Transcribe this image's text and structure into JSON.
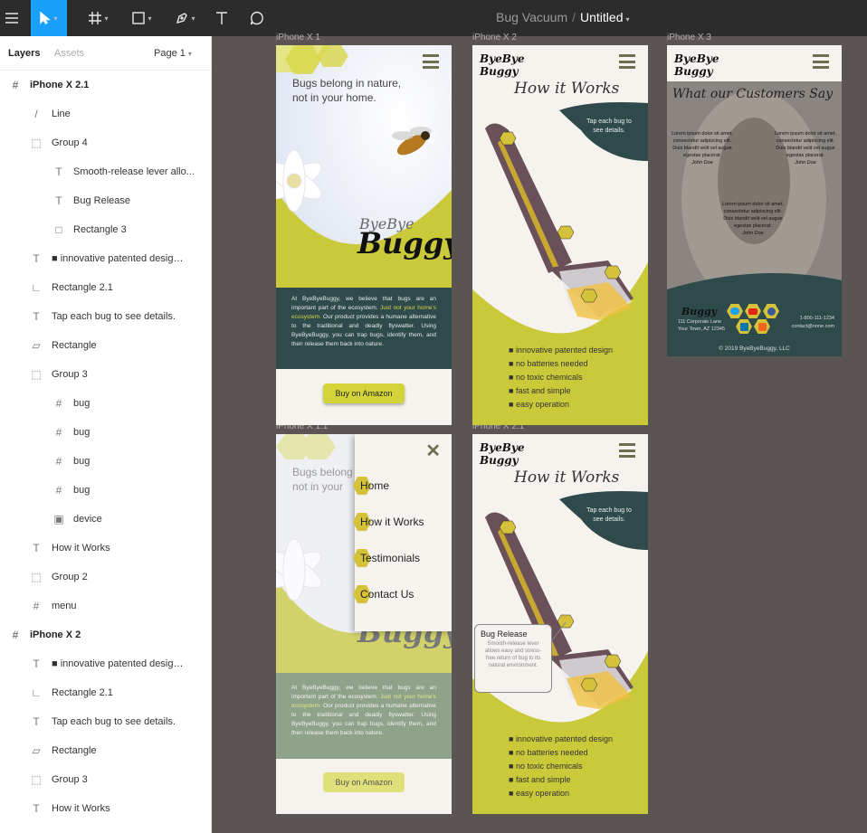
{
  "toolbar": {
    "project": "Bug Vacuum",
    "separator": "/",
    "document": "Untitled",
    "tools": [
      "menu-icon",
      "move-tool-icon",
      "frame-tool-icon",
      "shape-tool-icon",
      "pen-tool-icon",
      "text-tool-icon",
      "comment-tool-icon"
    ]
  },
  "panel": {
    "tab_layers": "Layers",
    "tab_assets": "Assets",
    "page": "Page 1",
    "layers": [
      {
        "label": "iPhone X 2.1",
        "icon": "#",
        "level": 0,
        "bold": true
      },
      {
        "label": "Line",
        "icon": "/",
        "level": 1
      },
      {
        "label": "Group 4",
        "icon": "⬚",
        "level": 1
      },
      {
        "label": "Smooth-release lever allo...",
        "icon": "T",
        "level": 2
      },
      {
        "label": "Bug Release",
        "icon": "T",
        "level": 2
      },
      {
        "label": "Rectangle 3",
        "icon": "□",
        "level": 2
      },
      {
        "label": "■ innovative patented design ...",
        "icon": "T",
        "level": 1
      },
      {
        "label": "Rectangle 2.1",
        "icon": "∟",
        "level": 1
      },
      {
        "label": "Tap each bug to see details.",
        "icon": "T",
        "level": 1
      },
      {
        "label": "Rectangle",
        "icon": "⏥",
        "level": 1
      },
      {
        "label": "Group 3",
        "icon": "⬚",
        "level": 1
      },
      {
        "label": "bug",
        "icon": "#",
        "level": 2
      },
      {
        "label": "bug",
        "icon": "#",
        "level": 2
      },
      {
        "label": "bug",
        "icon": "#",
        "level": 2
      },
      {
        "label": "bug",
        "icon": "#",
        "level": 2
      },
      {
        "label": "device",
        "icon": "▣",
        "level": 2
      },
      {
        "label": "How it Works",
        "icon": "T",
        "level": 1
      },
      {
        "label": "Group 2",
        "icon": "⬚",
        "level": 1
      },
      {
        "label": "menu",
        "icon": "#",
        "level": 1
      },
      {
        "label": "iPhone X 2",
        "icon": "#",
        "level": 0,
        "bold": true
      },
      {
        "label": "■ innovative patented design ...",
        "icon": "T",
        "level": 1
      },
      {
        "label": "Rectangle 2.1",
        "icon": "∟",
        "level": 1
      },
      {
        "label": "Tap each bug to see details.",
        "icon": "T",
        "level": 1
      },
      {
        "label": "Rectangle",
        "icon": "⏥",
        "level": 1
      },
      {
        "label": "Group 3",
        "icon": "⬚",
        "level": 1
      },
      {
        "label": "How it Works",
        "icon": "T",
        "level": 1
      }
    ]
  },
  "frames": {
    "x1": {
      "label": "iPhone X 1",
      "headline": "Bugs belong in nature,\nnot in your home.",
      "logo_top": "ByeBye",
      "logo_bottom": "Buggy",
      "body_a": "At ByeByeBuggy, we believe that bugs are an important part of the ecosystem. ",
      "body_hl": "Just not your home's ecosystem.",
      "body_b": " Our product provides a humane alternative to the traditional and deadly flyswatter. Using ByeByeBuggy, you can trap bugs, identify them, and then release them back into nature.",
      "cta": "Buy on Amazon"
    },
    "x2": {
      "label": "iPhone X 2",
      "title": "How it Works",
      "tap": "Tap each bug to see details.",
      "features": [
        "innovative patented design",
        "no batteries needed",
        "no toxic chemicals",
        "fast and simple",
        "easy operation"
      ]
    },
    "x3": {
      "label": "iPhone X 3",
      "title": "What our Customers Say",
      "lorem": "Lorem ipsum dolor sit amet, consectetur adipiscing elit. Duis blandit velit vel augue egestas placerat.",
      "author": "John Doe",
      "address1": "111 Corporate Lane",
      "address2": "Your Town, AZ 12345",
      "phone": "1-800-111-1234",
      "email": "contact@none.com",
      "copyright": "© 2019 ByeByeBuggy, LLC"
    },
    "x11": {
      "label": "iPhone X 1.1",
      "menu": [
        "Home",
        "How it Works",
        "Testimonials",
        "Contact Us"
      ],
      "headline": "Bugs belong\nnot in your",
      "logo_bottom": "Buggy",
      "cta": "Buy on Amazon"
    },
    "x21": {
      "label": "iPhone X 2.1",
      "title": "How it Works",
      "tap": "Tap each bug to see details.",
      "popup_title": "Bug Release",
      "popup_body": "Smooth-release lever allows easy and stress-free return of bug to its natural environment.",
      "features": [
        "innovative patented design",
        "no batteries needed",
        "no toxic chemicals",
        "fast and simple",
        "easy operation"
      ]
    }
  },
  "colors": {
    "yellow": "#c9c93a",
    "teal": "#2e4a4a",
    "cream": "#f6f3ee",
    "device": "#6a5058",
    "sage": "#8fa38a"
  }
}
